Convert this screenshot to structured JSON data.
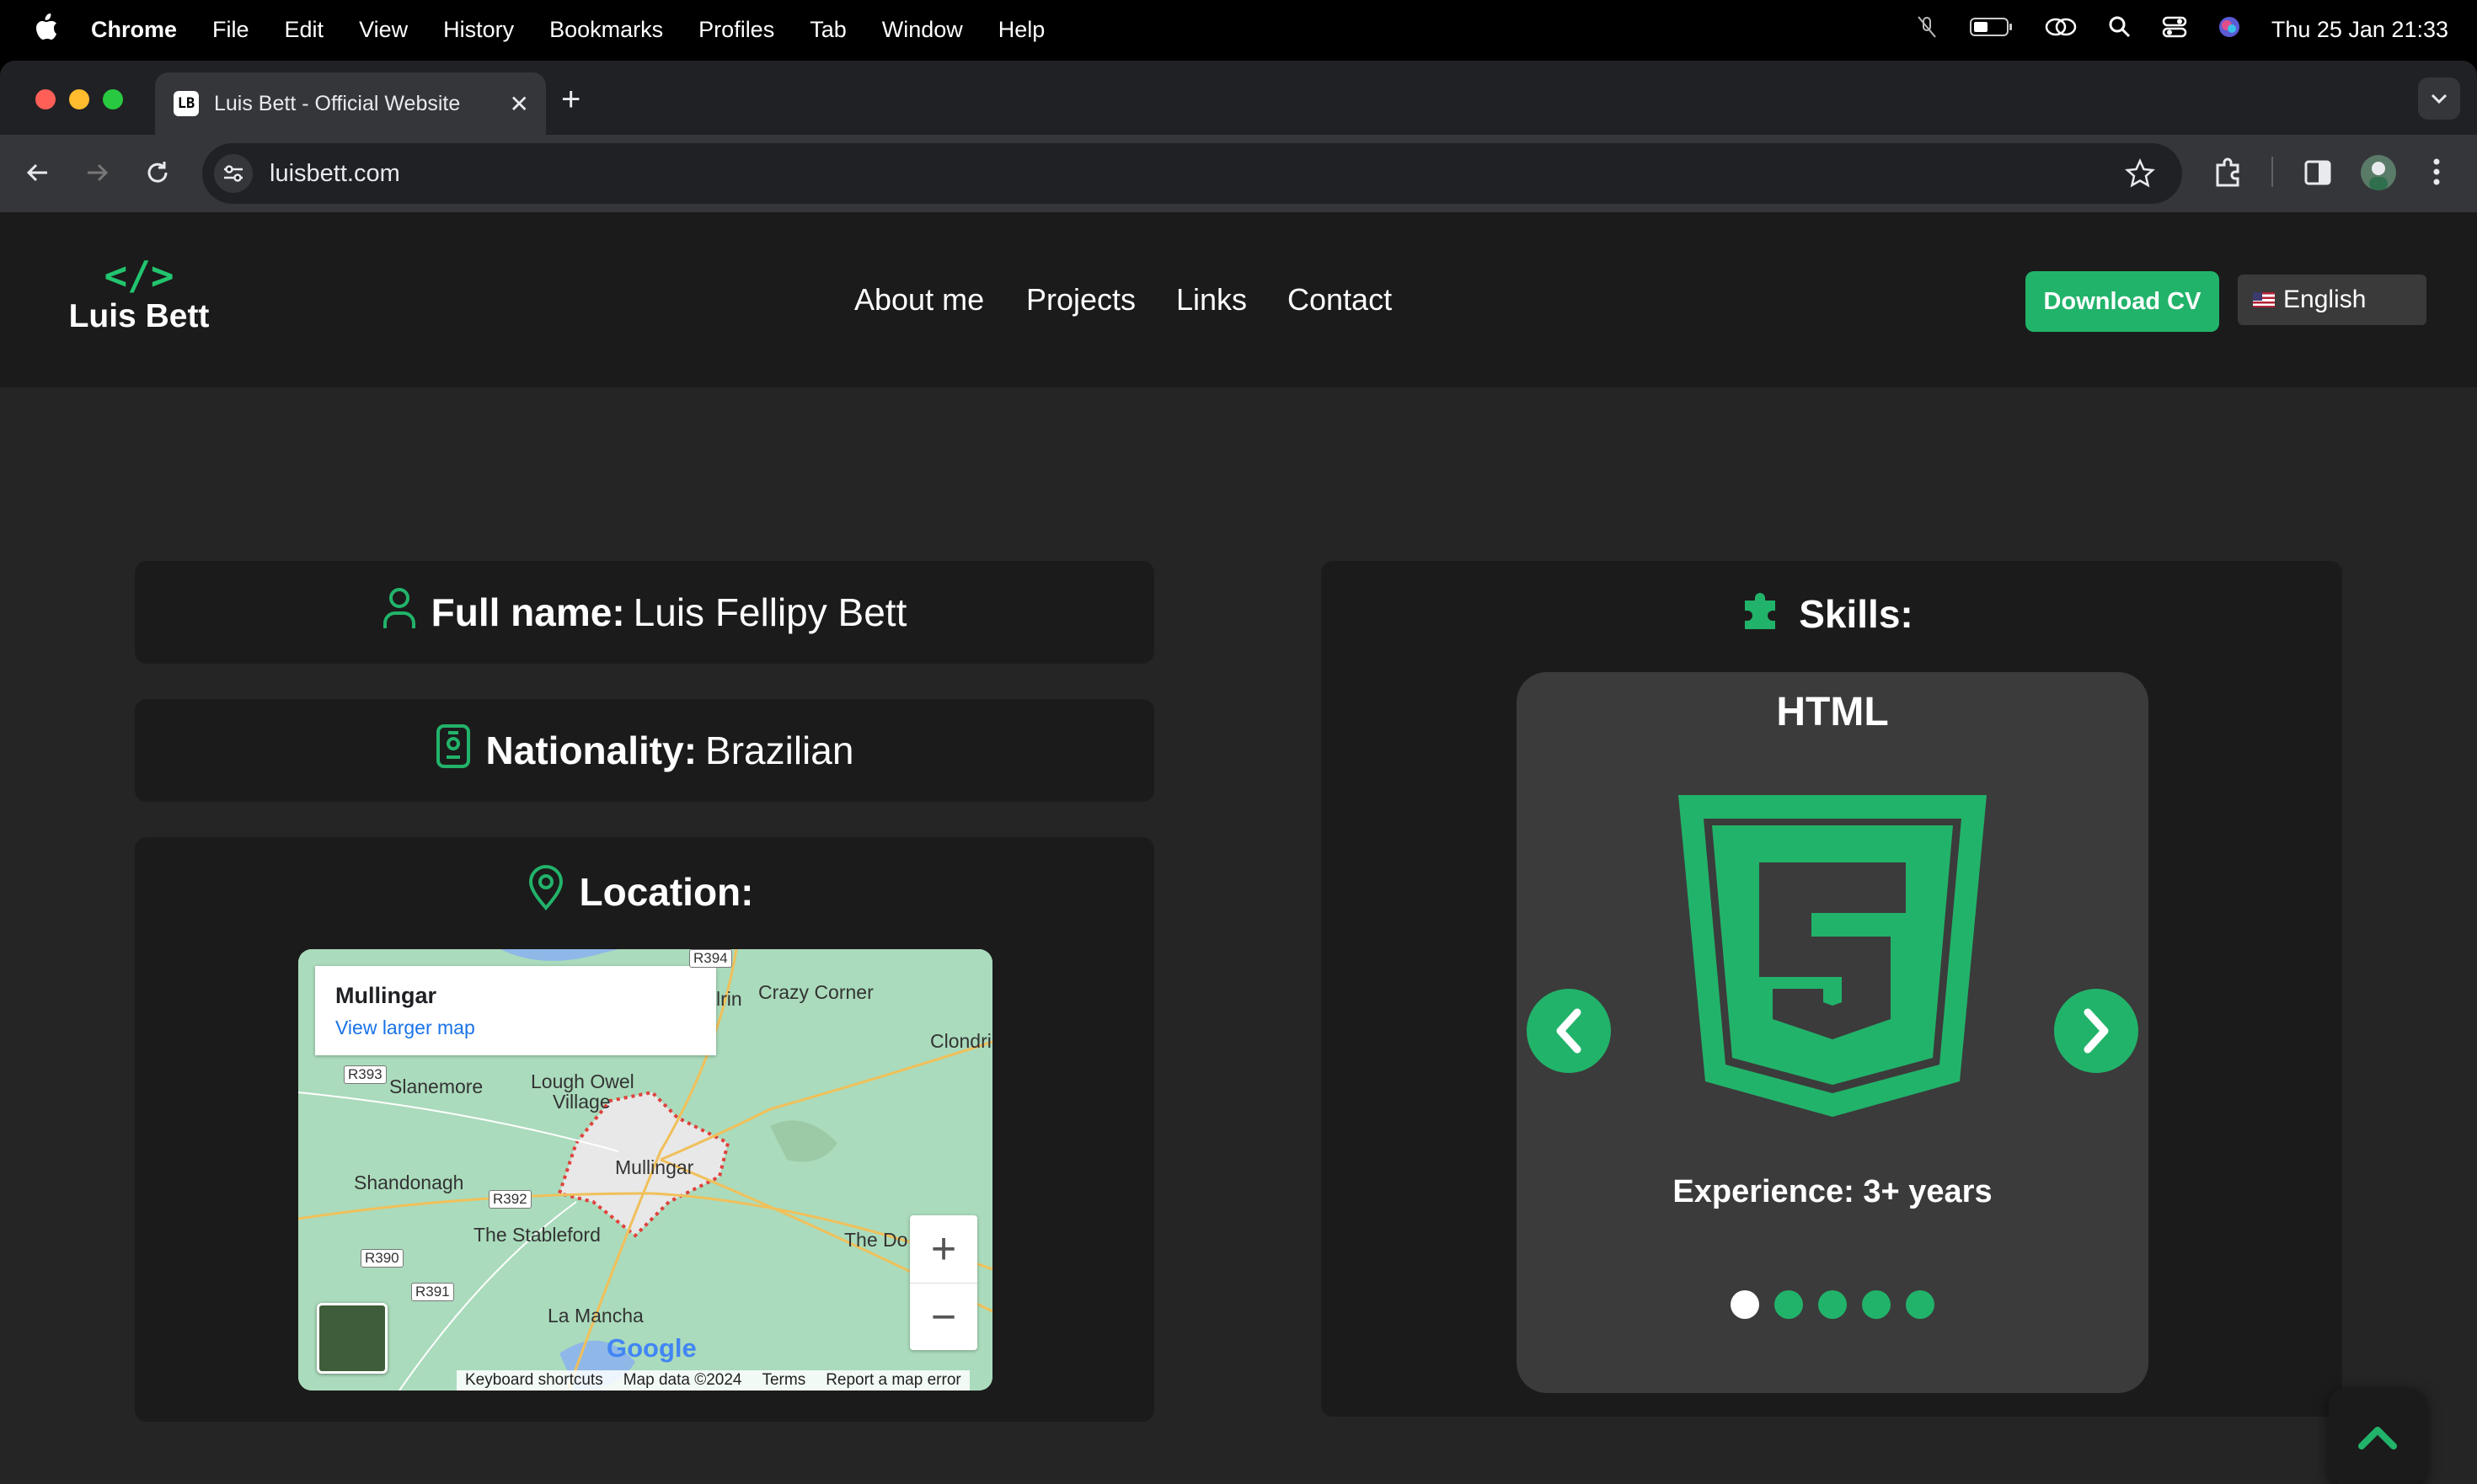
{
  "menubar": {
    "app": "Chrome",
    "items": [
      "File",
      "Edit",
      "View",
      "History",
      "Bookmarks",
      "Profiles",
      "Tab",
      "Window",
      "Help"
    ],
    "datetime": "Thu 25 Jan  21:33"
  },
  "browser": {
    "tab_title": "Luis Bett - Official Website",
    "favicon_text": "LB",
    "url": "luisbett.com"
  },
  "site": {
    "logo_code": "</>",
    "logo_name": "Luis Bett",
    "nav": [
      "About me",
      "Projects",
      "Links",
      "Contact"
    ],
    "cv_button": "Download CV",
    "language": "English"
  },
  "about": {
    "full_name_label": "Full name:",
    "full_name": "Luis Fellipy Bett",
    "nationality_label": "Nationality:",
    "nationality": "Brazilian",
    "location_label": "Location:"
  },
  "map": {
    "place": "Mullingar",
    "view_larger": "View larger map",
    "labels": [
      "Crazy Corner",
      "Clondri",
      "Slanemore",
      "Lough Owel",
      "Village",
      "Mullingar",
      "Shandonagh",
      "The Stableford",
      "The Do",
      "La Mancha",
      "lrin"
    ],
    "roads": [
      "R394",
      "R393",
      "R392",
      "R390",
      "R391"
    ],
    "brand": "Google",
    "footer": [
      "Keyboard shortcuts",
      "Map data ©2024",
      "Terms",
      "Report a map error"
    ],
    "zoom_in": "+",
    "zoom_out": "−"
  },
  "skills": {
    "title": "Skills:",
    "current": "HTML",
    "experience": "Experience: 3+ years",
    "active_index": 0,
    "total": 5
  },
  "colors": {
    "accent": "#22b36a",
    "nav_bg": "#1b1b1b",
    "page_bg": "#252525",
    "card_bg": "#1b1b1b"
  }
}
